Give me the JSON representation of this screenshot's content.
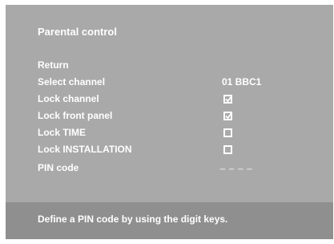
{
  "menu": {
    "title": "Parental control",
    "items": [
      {
        "label": "Return"
      },
      {
        "label": "Select channel",
        "value": "01 BBC1"
      },
      {
        "label": "Lock channel",
        "checked": true
      },
      {
        "label": "Lock front panel",
        "checked": true
      },
      {
        "label": "Lock TIME",
        "checked": false
      },
      {
        "label": "Lock INSTALLATION",
        "checked": false
      },
      {
        "label": "PIN code",
        "value": "_ _ _ _"
      }
    ]
  },
  "hint": {
    "text": "Define a PIN code by using the digit keys."
  },
  "colors": {
    "menu_background": "#a9a9a9",
    "hint_background": "#8f8f8f",
    "text": "#ffffff"
  },
  "icons": {
    "checked": "checkbox-checked-icon",
    "unchecked": "checkbox-unchecked-icon"
  }
}
